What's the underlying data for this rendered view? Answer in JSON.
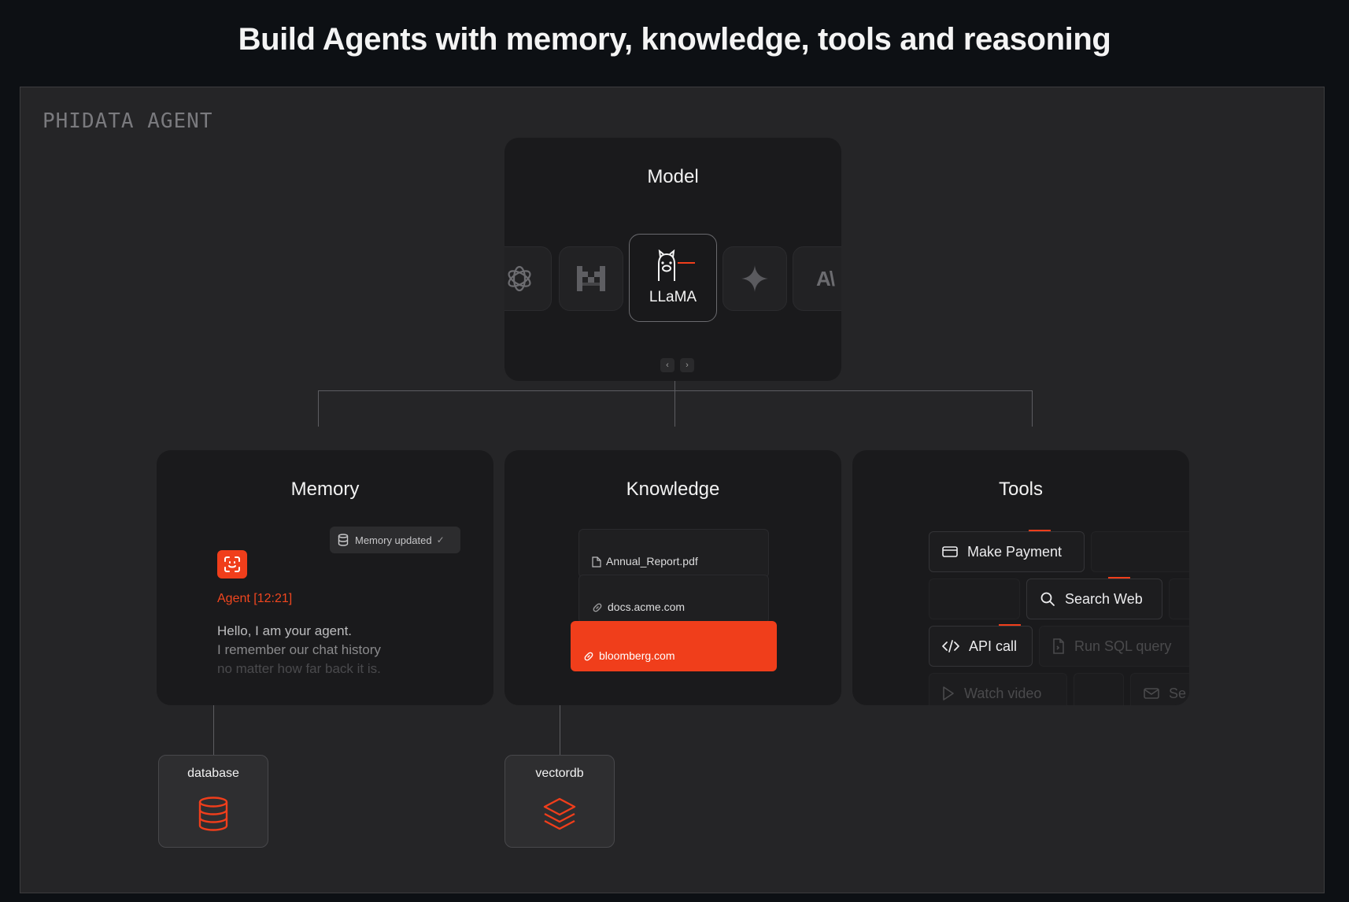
{
  "headline": "Build Agents with memory, knowledge, tools and reasoning",
  "stage_label": "PHIDATA AGENT",
  "model": {
    "title": "Model",
    "chips": [
      {
        "icon": "openai-icon"
      },
      {
        "icon": "mistral-icon"
      },
      {
        "icon": "llama-icon",
        "label": "LLaMA",
        "active": true
      },
      {
        "icon": "gemini-icon"
      },
      {
        "icon": "anthropic-icon",
        "label": "A\\"
      }
    ],
    "pager": {
      "prev": "‹",
      "next": "›"
    }
  },
  "memory": {
    "title": "Memory",
    "badge": "Memory updated",
    "badge_check": "✓",
    "agent_name": "Agent [12:21]",
    "message_lines": [
      "Hello, I am your agent.",
      "I remember our chat history",
      "no matter how far back it is."
    ]
  },
  "knowledge": {
    "title": "Knowledge",
    "documents": [
      {
        "icon": "file-icon",
        "label": "Annual_Report.pdf"
      },
      {
        "icon": "link-icon",
        "label": "docs.acme.com"
      },
      {
        "icon": "link-icon",
        "label": "bloomberg.com",
        "highlighted": true
      }
    ]
  },
  "tools": {
    "title": "Tools",
    "items": [
      {
        "icon": "card-icon",
        "label": "Make Payment"
      },
      {
        "icon": "search-icon",
        "label": "Search Web"
      },
      {
        "icon": "code-icon",
        "label": "API call"
      },
      {
        "icon": "sql-file-icon",
        "label": "Run SQL query"
      },
      {
        "icon": "play-icon",
        "label": "Watch video"
      },
      {
        "icon": "mail-icon",
        "label": "Se"
      }
    ]
  },
  "storage": [
    {
      "name": "database",
      "icon": "database-icon"
    },
    {
      "name": "vectordb",
      "icon": "layers-icon"
    }
  ],
  "colors": {
    "accent": "#f03e1b",
    "background": "#0d1014",
    "panel": "#252527",
    "card": "#1a1a1c"
  }
}
